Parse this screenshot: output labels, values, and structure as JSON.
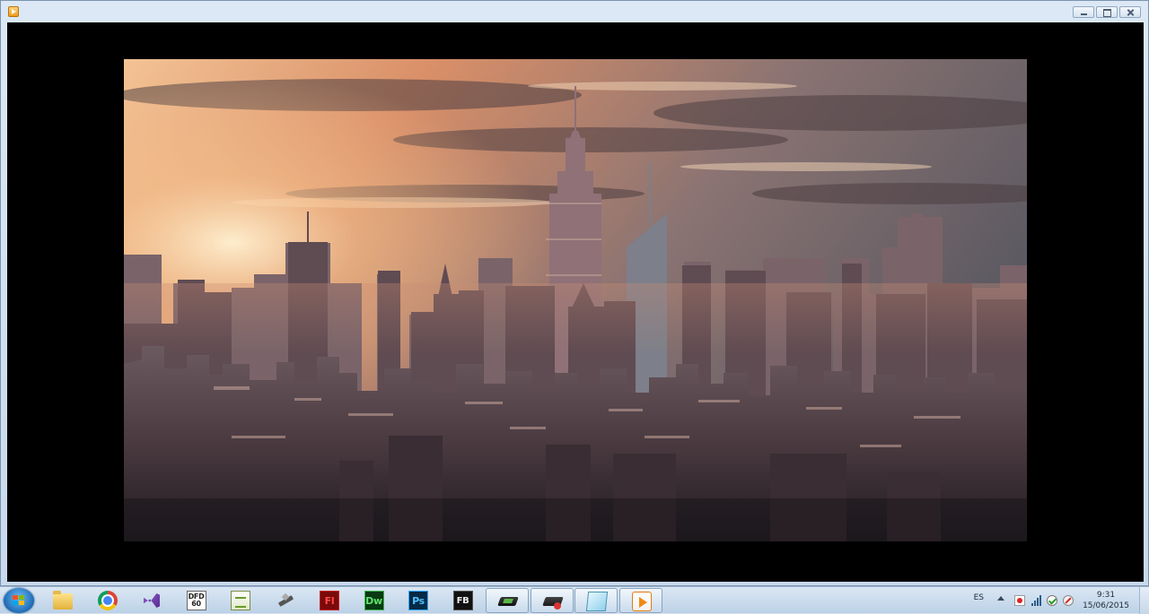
{
  "window": {
    "app_icon": "media-player-icon",
    "controls": {
      "minimize": "minimize-icon",
      "maximize": "maximize-icon",
      "close": "close-icon"
    }
  },
  "viewer": {
    "image": "city-skyline-photo",
    "colors": {
      "sky_warm": "#e89a6a",
      "sky_cool": "#5f5c63",
      "city_dark": "#2a2228"
    }
  },
  "taskbar": {
    "start": "windows-start-icon",
    "items": [
      {
        "name": "file-explorer-icon"
      },
      {
        "name": "chrome-icon"
      },
      {
        "name": "visual-studio-icon"
      },
      {
        "name": "dfd-icon",
        "label_top": "DFD",
        "label_bottom": "60"
      },
      {
        "name": "notepad-plus-icon"
      },
      {
        "name": "pen-tool-icon"
      },
      {
        "name": "flash-icon",
        "label": "Fl"
      },
      {
        "name": "dreamweaver-icon",
        "label": "Dw"
      },
      {
        "name": "photoshop-icon",
        "label": "Ps"
      },
      {
        "name": "flash-builder-icon",
        "label": "FB"
      },
      {
        "name": "game-icon"
      },
      {
        "name": "game-icon-2"
      },
      {
        "name": "document-icon"
      },
      {
        "name": "media-player-icon"
      }
    ],
    "tray": {
      "language": "ES",
      "time": "9:31",
      "date": "15/06/2015"
    }
  }
}
